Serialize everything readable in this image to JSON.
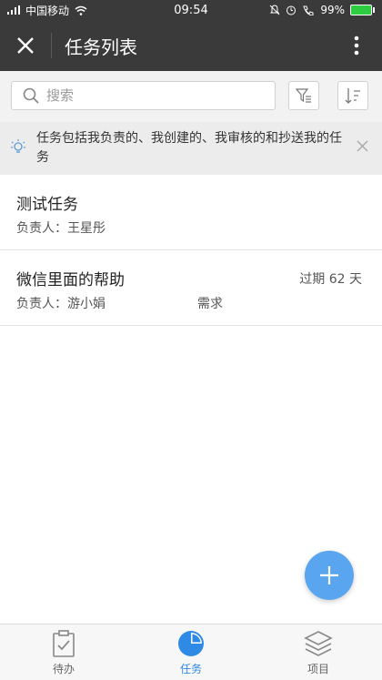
{
  "statusbar": {
    "carrier": "中国移动",
    "time": "09:54",
    "battery": "99%"
  },
  "topbar": {
    "title": "任务列表"
  },
  "search": {
    "placeholder": "搜索"
  },
  "notice": {
    "text": "任务包括我负责的、我创建的、我审核的和抄送我的任务"
  },
  "tasks": [
    {
      "name": "测试任务",
      "owner": "负责人：王星彤",
      "tag": "",
      "overdue": ""
    },
    {
      "name": "微信里面的帮助",
      "owner": "负责人：游小娟",
      "tag": "需求",
      "overdue": "过期 62 天"
    }
  ],
  "tabs": [
    {
      "label": "待办",
      "icon": "clipboard-icon"
    },
    {
      "label": "任务",
      "icon": "pie-chart-icon"
    },
    {
      "label": "项目",
      "icon": "layers-icon"
    }
  ],
  "colors": {
    "accent": "#2f8ae5",
    "fab": "#5aa5ef",
    "topbar": "#3a3a3a"
  }
}
